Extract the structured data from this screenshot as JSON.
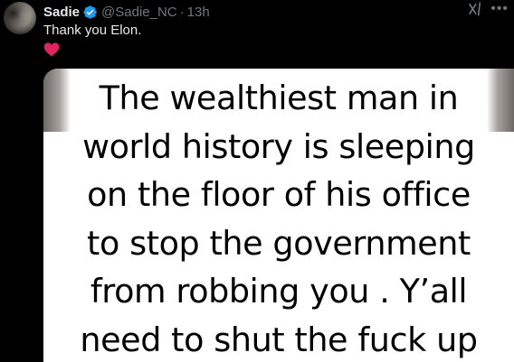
{
  "author": {
    "name": "Sadie",
    "handle": "@Sadie_NC",
    "separator": "·",
    "time": "13h",
    "verified": true
  },
  "post": {
    "text": "Thank you Elon.",
    "emoji": "heart-icon"
  },
  "media": {
    "caption": "The wealthiest man in\nworld history is sleeping\non the floor of his office\nto stop the government\nfrom robbing you . Y’all\nneed to shut the fuck up"
  },
  "icons": {
    "grok": "grok-icon",
    "more": "more-options-icon",
    "verified": "verified-badge-icon"
  },
  "colors": {
    "background": "#000000",
    "text": "#e7e9ea",
    "muted": "#71767b",
    "verified": "#1d9bf0",
    "heart": "#e0245e"
  }
}
